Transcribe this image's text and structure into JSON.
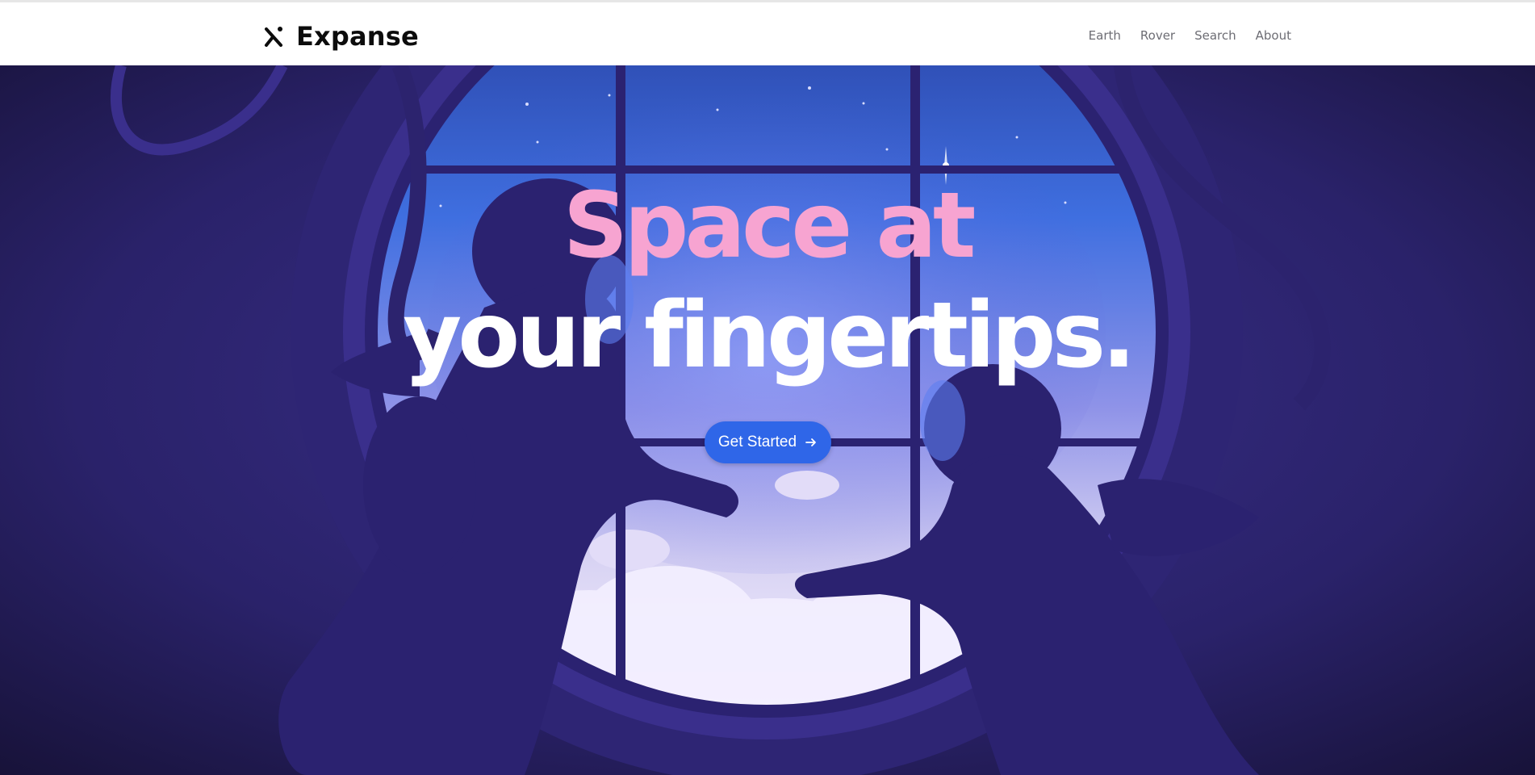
{
  "brand": {
    "name": "Expanse",
    "logo_icon": "x-star-logo-icon"
  },
  "nav": {
    "items": [
      "Earth",
      "Rover",
      "Search",
      "About"
    ]
  },
  "hero": {
    "headline_line1": "Space at",
    "headline_line2": "your fingertips.",
    "cta_label": "Get Started",
    "cta_icon": "arrow-right-icon"
  },
  "colors": {
    "accent_pink": "#f7a4d1",
    "button_blue": "#2f66e8",
    "hero_dark": "#1d1745",
    "window_blue": "#3b63d8"
  }
}
